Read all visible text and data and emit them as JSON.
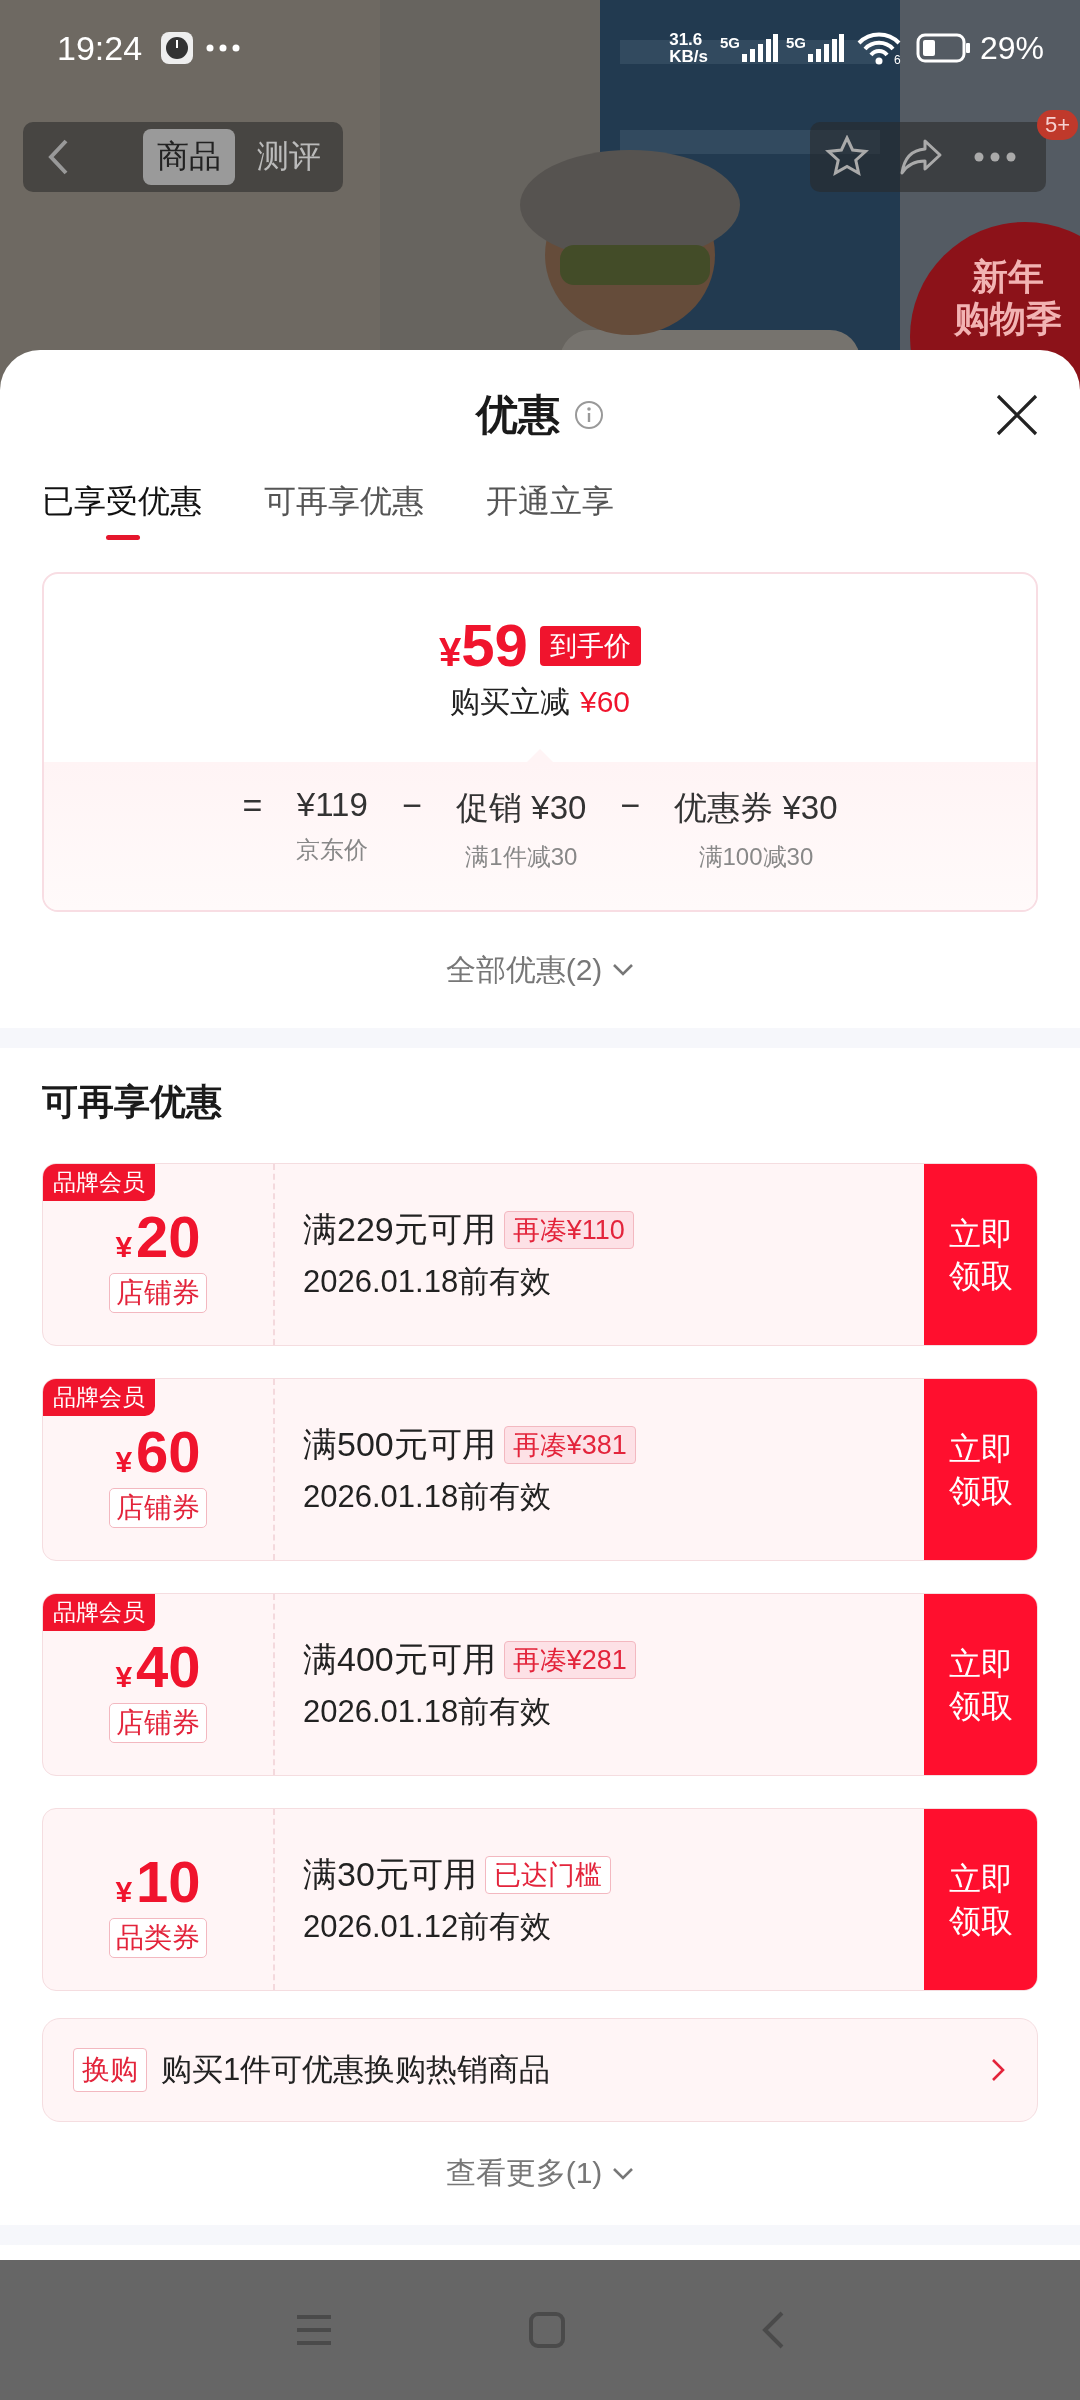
{
  "status_bar": {
    "time": "19:24",
    "speed_value": "31.6",
    "speed_unit": "KB/s",
    "signal_labels": [
      "5G",
      "5G"
    ],
    "wifi_label": "6",
    "battery": "29%"
  },
  "header": {
    "tabs": [
      {
        "label": "商品",
        "selected": true
      },
      {
        "label": "测评",
        "selected": false
      }
    ],
    "badge": "5+"
  },
  "promo_badge": {
    "lines": [
      "新年",
      "购物季"
    ]
  },
  "sheet": {
    "title": "优惠",
    "tabs": [
      {
        "label": "已享受优惠",
        "selected": true
      },
      {
        "label": "可再享优惠",
        "selected": false
      },
      {
        "label": "开通立享",
        "selected": false
      }
    ],
    "summary": {
      "currency": "¥",
      "price": "59",
      "price_tag": "到手价",
      "saving_label": "购买立减",
      "saving": "¥60",
      "formula": [
        {
          "kind": "operator",
          "text": "="
        },
        {
          "kind": "term",
          "value": "¥119",
          "caption": "京东价"
        },
        {
          "kind": "operator",
          "text": "−"
        },
        {
          "kind": "term",
          "value": "促销 ¥30",
          "caption": "满1件减30"
        },
        {
          "kind": "operator",
          "text": "−"
        },
        {
          "kind": "term",
          "value": "优惠券 ¥30",
          "caption": "满100减30"
        }
      ]
    },
    "all_link": "全部优惠(2)"
  },
  "more_section": {
    "title": "可再享优惠",
    "coupons": [
      {
        "member_tag": "品牌会员",
        "currency": "¥",
        "amount": "20",
        "type": "店铺券",
        "condition": "满229元可用",
        "note": "再凑¥110",
        "note_filled": true,
        "validity": "2026.01.18前有效",
        "action": "立即领取"
      },
      {
        "member_tag": "品牌会员",
        "currency": "¥",
        "amount": "60",
        "type": "店铺券",
        "condition": "满500元可用",
        "note": "再凑¥381",
        "note_filled": true,
        "validity": "2026.01.18前有效",
        "action": "立即领取"
      },
      {
        "member_tag": "品牌会员",
        "currency": "¥",
        "amount": "40",
        "type": "店铺券",
        "condition": "满400元可用",
        "note": "再凑¥281",
        "note_filled": true,
        "validity": "2026.01.18前有效",
        "action": "立即领取"
      },
      {
        "currency": "¥",
        "amount": "10",
        "type": "品类券",
        "condition": "满30元可用",
        "note": "已达门槛",
        "note_filled": false,
        "validity": "2026.01.12前有效",
        "action": "立即领取"
      }
    ],
    "exchange": {
      "tag": "换购",
      "text": "购买1件可优惠换购热销商品"
    },
    "more_link": "查看更多(1)"
  }
}
